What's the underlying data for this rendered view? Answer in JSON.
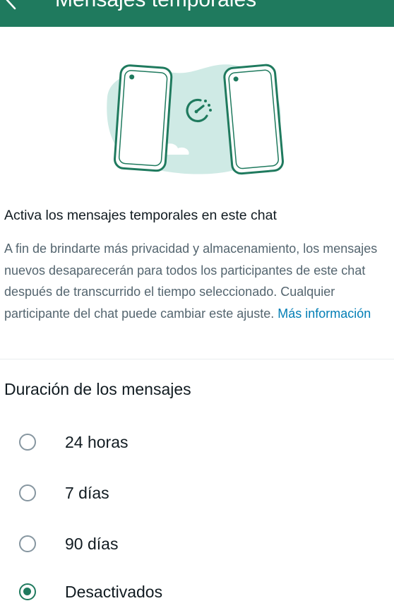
{
  "app_bar": {
    "title": "Mensajes temporales",
    "background": "#1f7a5e",
    "back_icon": "arrow-back-icon"
  },
  "illustration": {
    "icon": "disappearing-messages-timer-icon",
    "colors": {
      "blob": "#cfeae5",
      "outline": "#1f7a5e",
      "cloud": "#ffffff"
    }
  },
  "info": {
    "heading": "Activa los mensajes temporales en este chat",
    "body": "A fin de brindarte más privacidad y almacenamiento, los mensajes nuevos desaparecerán para todos los participantes de este chat después de transcurrido el tiempo seleccionado. Cualquier participante del chat puede cambiar este ajuste.",
    "link": "Más información",
    "link_color": "#027eb5"
  },
  "duration": {
    "title": "Duración de los mensajes",
    "options": [
      {
        "label": "24 horas",
        "selected": false
      },
      {
        "label": "7 días",
        "selected": false
      },
      {
        "label": "90 días",
        "selected": false
      },
      {
        "label": "Desactivados",
        "selected": true
      }
    ],
    "accent": "#1f7a5e"
  }
}
